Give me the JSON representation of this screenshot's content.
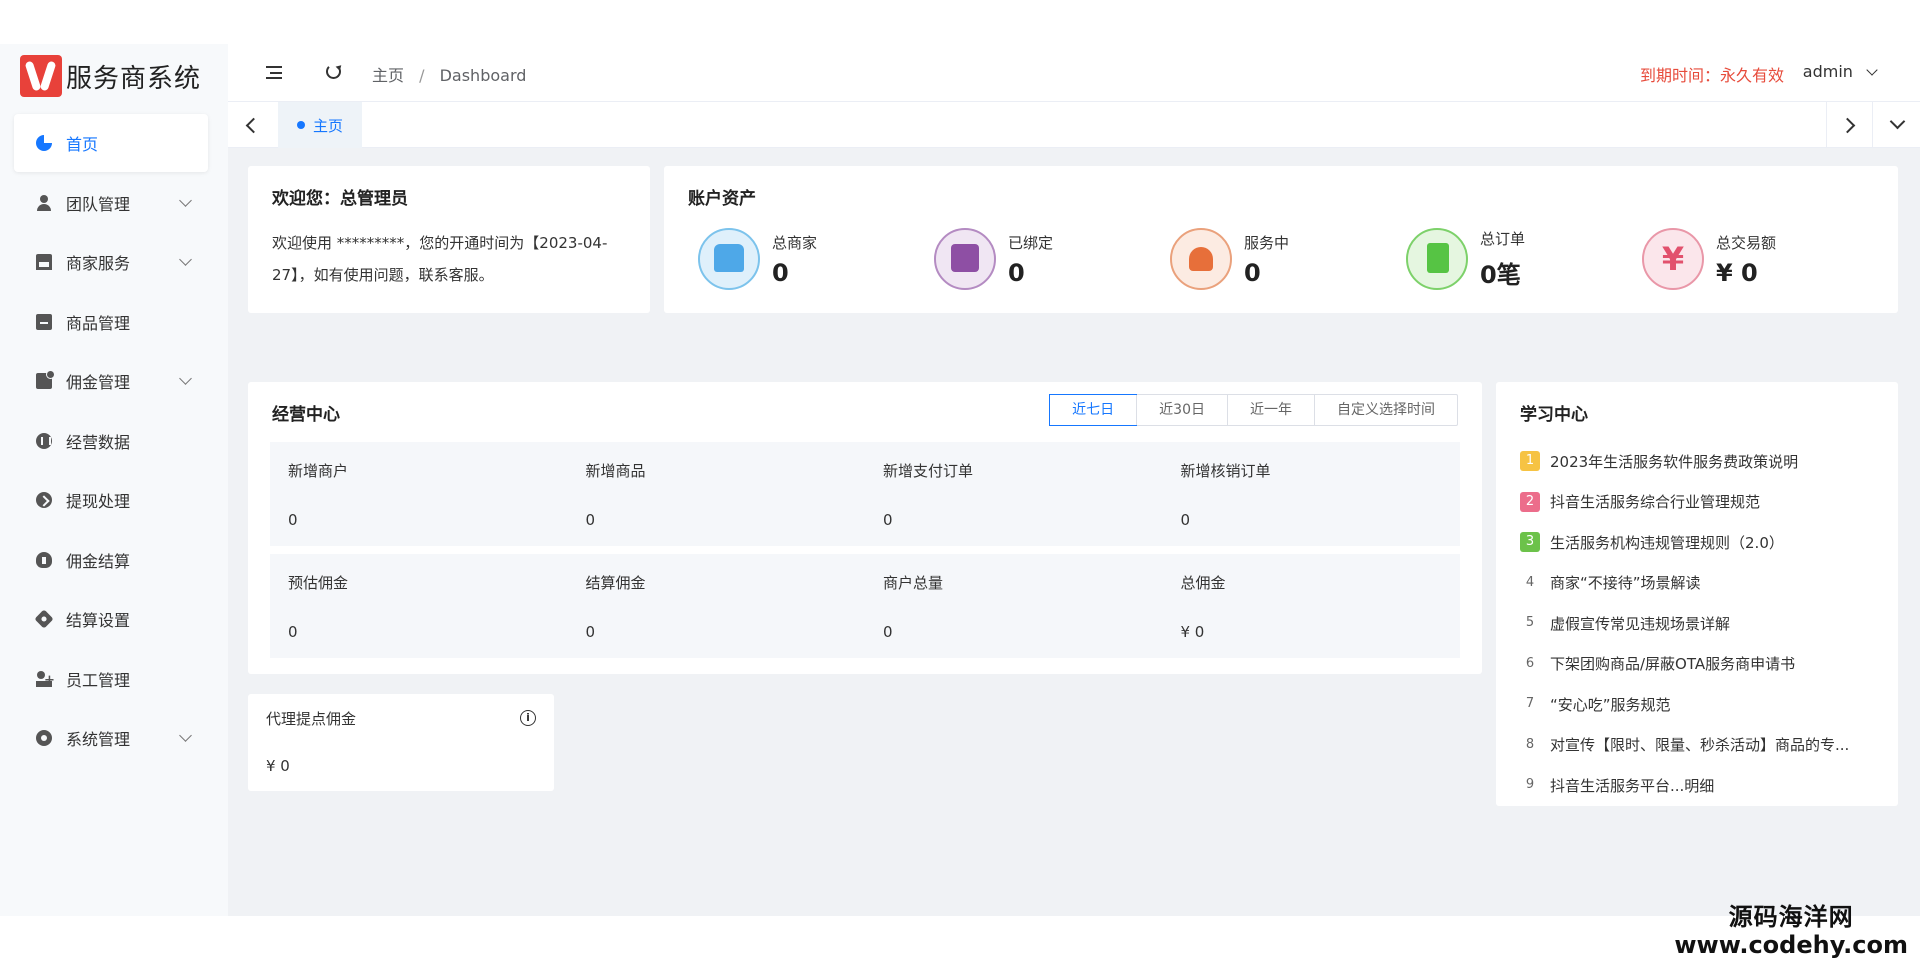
{
  "app": {
    "title": "服务商系统"
  },
  "sidebar": {
    "items": [
      {
        "label": "首页",
        "icon": "dashboard-icon",
        "active": true
      },
      {
        "label": "团队管理",
        "icon": "user-icon",
        "expandable": true
      },
      {
        "label": "商家服务",
        "icon": "shop-icon",
        "expandable": true
      },
      {
        "label": "商品管理",
        "icon": "goods-icon"
      },
      {
        "label": "佣金管理",
        "icon": "commission-icon",
        "expandable": true
      },
      {
        "label": "经营数据",
        "icon": "data-icon"
      },
      {
        "label": "提现处理",
        "icon": "withdraw-icon"
      },
      {
        "label": "佣金结算",
        "icon": "settle-icon"
      },
      {
        "label": "结算设置",
        "icon": "settle-settings-icon"
      },
      {
        "label": "员工管理",
        "icon": "staff-icon"
      },
      {
        "label": "系统管理",
        "icon": "system-icon",
        "expandable": true
      }
    ]
  },
  "header": {
    "breadcrumb": [
      "主页",
      "Dashboard"
    ],
    "breadcrumb_sep": "/",
    "expire_text": "到期时间：永久有效",
    "user": "admin"
  },
  "tabs": [
    {
      "label": "主页",
      "active": true
    }
  ],
  "welcome": {
    "title": "欢迎您：总管理员",
    "text": "欢迎使用 *********，您的开通时间为【2023-04-27】，如有使用问题，联系客服。"
  },
  "assets": {
    "title": "账户资产",
    "items": [
      {
        "label": "总商家",
        "value": "0",
        "icon": "store-icon",
        "color": "#4ea8e8"
      },
      {
        "label": "已绑定",
        "value": "0",
        "icon": "bound-icon",
        "color": "#8e4fa4"
      },
      {
        "label": "服务中",
        "value": "0",
        "icon": "service-icon",
        "color": "#e76f3a"
      },
      {
        "label": "总订单",
        "value": "0笔",
        "icon": "order-icon",
        "color": "#56c444"
      },
      {
        "label": "总交易额",
        "value": "¥ 0",
        "icon": "yen-icon",
        "color": "#e2516d"
      }
    ]
  },
  "operations": {
    "title": "经营中心",
    "filters": [
      "近七日",
      "近30日",
      "近一年",
      "自定义选择时间"
    ],
    "active_filter": 0,
    "stats": [
      [
        {
          "label": "新增商户",
          "value": "0"
        },
        {
          "label": "新增商品",
          "value": "0"
        },
        {
          "label": "新增支付订单",
          "value": "0"
        },
        {
          "label": "新增核销订单",
          "value": "0"
        }
      ],
      [
        {
          "label": "预估佣金",
          "value": "0"
        },
        {
          "label": "结算佣金",
          "value": "0"
        },
        {
          "label": "商户总量",
          "value": "0"
        },
        {
          "label": "总佣金",
          "value": "¥ 0"
        }
      ]
    ]
  },
  "learning": {
    "title": "学习中心",
    "items": [
      {
        "rank": "1",
        "title": "2023年生活服务软件服务费政策说明"
      },
      {
        "rank": "2",
        "title": "抖音生活服务综合行业管理规范"
      },
      {
        "rank": "3",
        "title": "生活服务机构违规管理规则（2.0）"
      },
      {
        "rank": "4",
        "title": "商家“不接待”场景解读"
      },
      {
        "rank": "5",
        "title": "虚假宣传常见违规场景详解"
      },
      {
        "rank": "6",
        "title": "下架团购商品/屏蔽OTA服务商申请书"
      },
      {
        "rank": "7",
        "title": "“安心吃”服务规范"
      },
      {
        "rank": "8",
        "title": "对宣传【限时、限量、秒杀活动】商品的专..."
      },
      {
        "rank": "9",
        "title": "抖音生活服务平台...明细"
      }
    ]
  },
  "agent": {
    "title": "代理提点佣金",
    "value": "¥ 0",
    "info_icon": "info-icon"
  },
  "watermark": {
    "line1": "源码海洋网",
    "line2": "www.codehy.com"
  }
}
